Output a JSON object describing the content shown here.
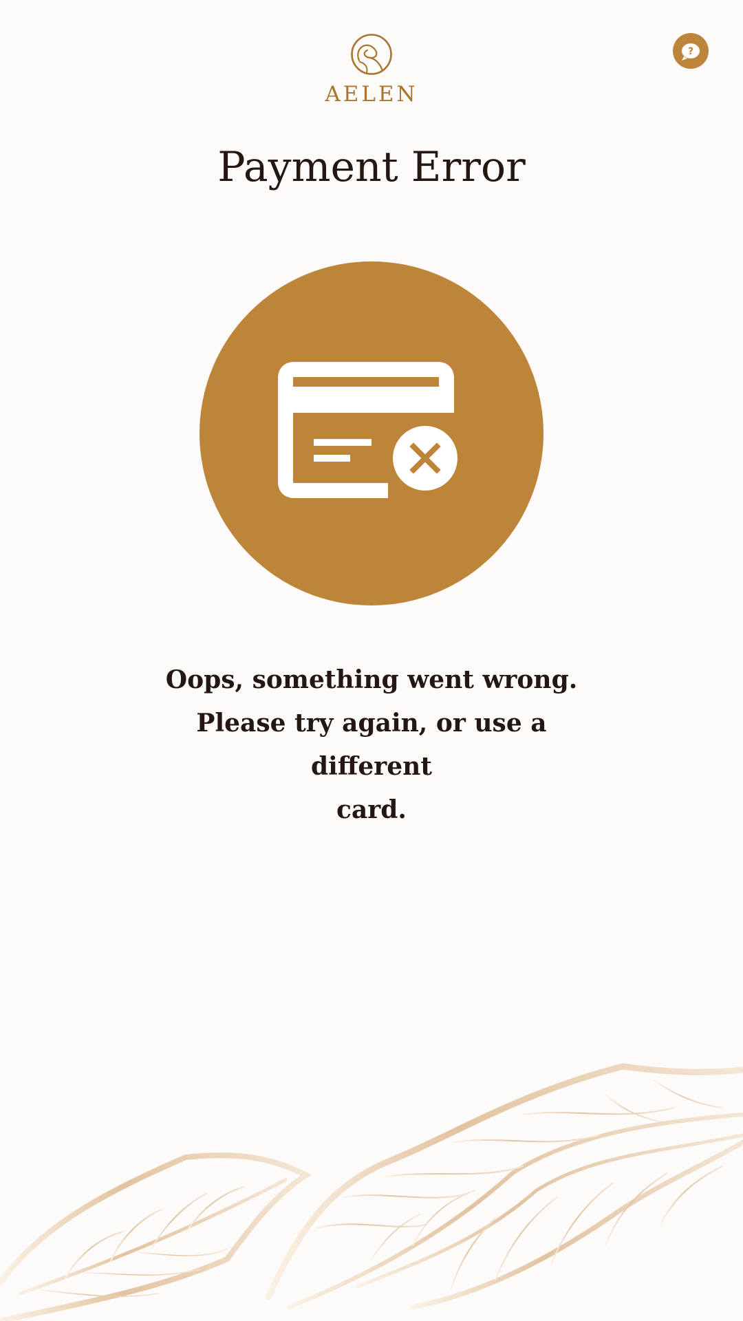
{
  "brand": {
    "name": "AELEN",
    "logo_icon": "aelen-monogram-icon",
    "accent_color": "#bd853a",
    "text_color": "#241611",
    "background_color": "#fcfbf9"
  },
  "header": {
    "help_icon": "help-chat-icon",
    "help_symbol": "?"
  },
  "page": {
    "title": "Payment Error",
    "status_icon": "card-declined-icon",
    "message_lines": [
      "Oops, something went wrong.",
      "Please try again, or use a different",
      "card."
    ]
  },
  "decoration": {
    "icon": "leaf-pattern-decoration"
  }
}
